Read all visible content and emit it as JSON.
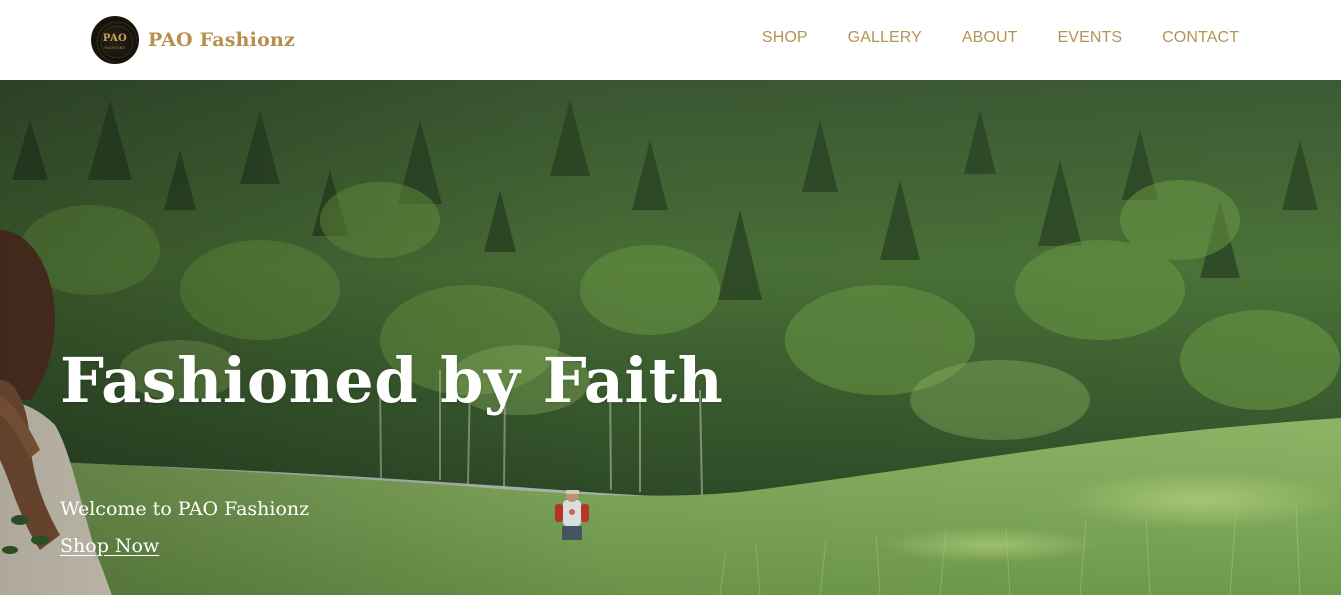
{
  "brand": {
    "logo_text": "PAO",
    "logo_subtext": "FASHIONZ",
    "name": "PAO Fashionz"
  },
  "nav": {
    "items": [
      {
        "label": "SHOP"
      },
      {
        "label": "GALLERY"
      },
      {
        "label": "ABOUT"
      },
      {
        "label": "EVENTS"
      },
      {
        "label": "CONTACT"
      }
    ]
  },
  "hero": {
    "title": "Fashioned by Faith",
    "welcome": "Welcome to PAO Fashionz",
    "cta_label": "Shop Now",
    "image_icon": "forest-meadow-photo"
  },
  "colors": {
    "accent_gold": "#b39453",
    "header_bg": "#ffffff",
    "hero_text": "#ffffff"
  }
}
